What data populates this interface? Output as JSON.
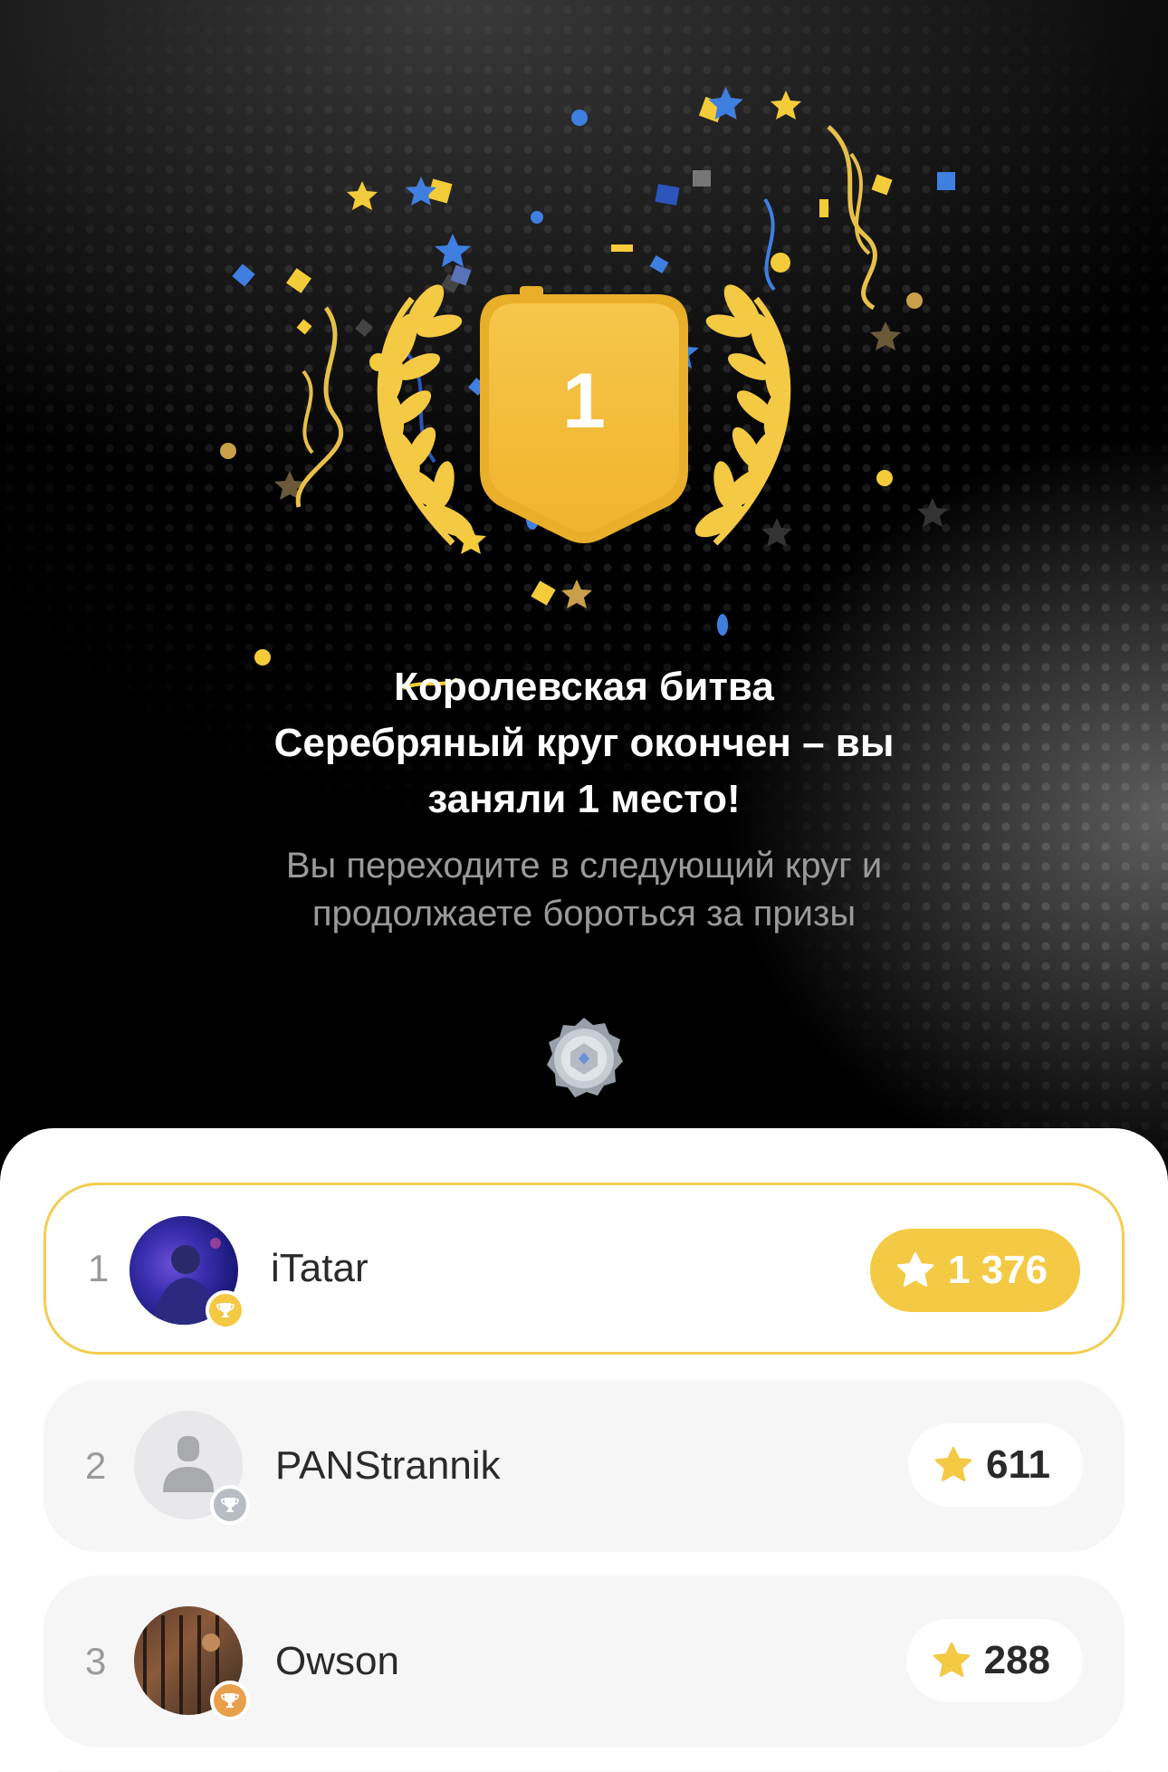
{
  "hero": {
    "badge_number": "1",
    "title_lines": [
      "Королевская битва",
      "Серебряный круг окончен – вы",
      "заняли 1 место!"
    ],
    "subtitle_lines": [
      "Вы переходите в следующий круг и",
      "продолжаете бороться за призы"
    ]
  },
  "leaderboard": [
    {
      "rank": "1",
      "name": "iTatar",
      "score": "1 376",
      "cup": "gold",
      "highlighted": true
    },
    {
      "rank": "2",
      "name": "PANStrannik",
      "score": "611",
      "cup": "silver",
      "highlighted": false
    },
    {
      "rank": "3",
      "name": "Owson",
      "score": "288",
      "cup": "bronze",
      "highlighted": false
    }
  ],
  "icons": {
    "badge": "shield-badge-icon",
    "laurel": "laurel-wreath-icon",
    "league": "silver-league-emblem-icon",
    "score": "star-icon",
    "cup": "trophy-icon"
  },
  "colors": {
    "gold": "#f4c944",
    "highlight_border": "#f2cd52",
    "silver_cup": "#b8bcc4",
    "bronze_cup": "#e8a04c"
  }
}
